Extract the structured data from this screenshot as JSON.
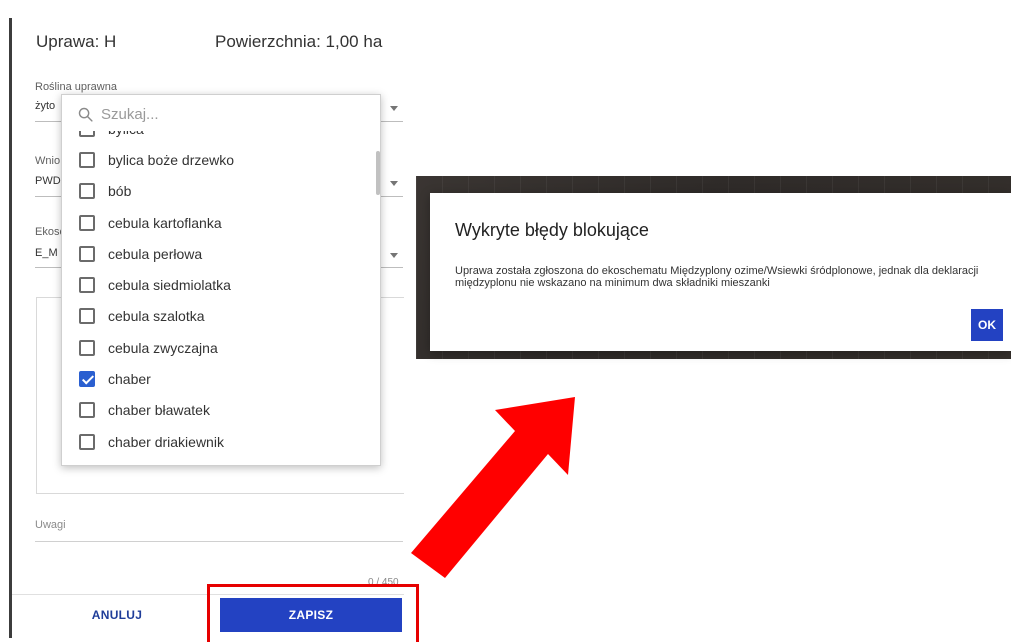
{
  "form": {
    "crop_label": "Uprawa: H",
    "area_label": "Powierzchnia: 1,00 ha",
    "fields": [
      {
        "label": "Roślina uprawna",
        "value": "żyto"
      },
      {
        "label": "Wnio",
        "value": "PWD"
      },
      {
        "label": "Ekosc",
        "value": "E_M"
      }
    ],
    "notes_label": "Uwagi",
    "notes_counter": "0 / 450",
    "cancel_label": "ANULUJ",
    "save_label": "ZAPISZ"
  },
  "dropdown": {
    "search_placeholder": "Szukaj...",
    "items": [
      {
        "label": "bylica",
        "checked": false
      },
      {
        "label": "bylica boże drzewko",
        "checked": false
      },
      {
        "label": "bób",
        "checked": false
      },
      {
        "label": "cebula kartoflanka",
        "checked": false
      },
      {
        "label": "cebula perłowa",
        "checked": false
      },
      {
        "label": "cebula siedmiolatka",
        "checked": false
      },
      {
        "label": "cebula szalotka",
        "checked": false
      },
      {
        "label": "cebula zwyczajna",
        "checked": false
      },
      {
        "label": "chaber",
        "checked": true
      },
      {
        "label": "chaber bławatek",
        "checked": false
      },
      {
        "label": "chaber driakiewnik",
        "checked": false
      },
      {
        "label": "",
        "checked": false
      }
    ]
  },
  "modal": {
    "title": "Wykryte błędy blokujące",
    "message": "Uprawa została zgłoszona do ekoschematu Międzyplony ozime/Wsiewki śródplonowe, jednak dla deklaracji międzyplonu nie wskazano na minimum dwa składniki mieszanki",
    "ok_label": "OK"
  },
  "colors": {
    "primary": "#2342c2",
    "highlight": "#e60000",
    "checkbox": "#2a5fd0"
  }
}
